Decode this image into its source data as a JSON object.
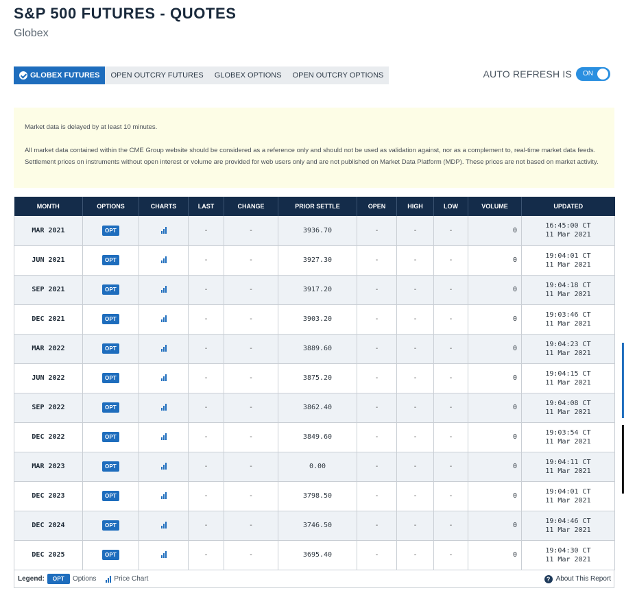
{
  "header": {
    "title": "S&P 500 FUTURES - QUOTES",
    "subtitle": "Globex"
  },
  "tabs": [
    {
      "label": "GLOBEX FUTURES",
      "active": true
    },
    {
      "label": "OPEN OUTCRY FUTURES",
      "active": false
    },
    {
      "label": "GLOBEX OPTIONS",
      "active": false
    },
    {
      "label": "OPEN OUTCRY OPTIONS",
      "active": false
    }
  ],
  "auto_refresh": {
    "label": "AUTO REFRESH IS",
    "state": "ON"
  },
  "notice": {
    "line1": "Market data is delayed by at least 10 minutes.",
    "line2": "All market data contained within the CME Group website should be considered as a reference only and should not be used as validation against, nor as a complement to, real-time market data feeds. Settlement prices on instruments without open interest or volume are provided for web users only and are not published on Market Data Platform (MDP). These prices are not based on market activity."
  },
  "table": {
    "columns": [
      "MONTH",
      "OPTIONS",
      "CHARTS",
      "LAST",
      "CHANGE",
      "PRIOR SETTLE",
      "OPEN",
      "HIGH",
      "LOW",
      "VOLUME",
      "UPDATED"
    ],
    "opt_label": "OPT",
    "rows": [
      {
        "month": "MAR 2021",
        "last": "-",
        "change": "-",
        "prior_settle": "3936.70",
        "open": "-",
        "high": "-",
        "low": "-",
        "volume": "0",
        "time": "16:45:00 CT",
        "date": "11 Mar 2021"
      },
      {
        "month": "JUN 2021",
        "last": "-",
        "change": "-",
        "prior_settle": "3927.30",
        "open": "-",
        "high": "-",
        "low": "-",
        "volume": "0",
        "time": "19:04:01 CT",
        "date": "11 Mar 2021"
      },
      {
        "month": "SEP 2021",
        "last": "-",
        "change": "-",
        "prior_settle": "3917.20",
        "open": "-",
        "high": "-",
        "low": "-",
        "volume": "0",
        "time": "19:04:18 CT",
        "date": "11 Mar 2021"
      },
      {
        "month": "DEC 2021",
        "last": "-",
        "change": "-",
        "prior_settle": "3903.20",
        "open": "-",
        "high": "-",
        "low": "-",
        "volume": "0",
        "time": "19:03:46 CT",
        "date": "11 Mar 2021"
      },
      {
        "month": "MAR 2022",
        "last": "-",
        "change": "-",
        "prior_settle": "3889.60",
        "open": "-",
        "high": "-",
        "low": "-",
        "volume": "0",
        "time": "19:04:23 CT",
        "date": "11 Mar 2021"
      },
      {
        "month": "JUN 2022",
        "last": "-",
        "change": "-",
        "prior_settle": "3875.20",
        "open": "-",
        "high": "-",
        "low": "-",
        "volume": "0",
        "time": "19:04:15 CT",
        "date": "11 Mar 2021"
      },
      {
        "month": "SEP 2022",
        "last": "-",
        "change": "-",
        "prior_settle": "3862.40",
        "open": "-",
        "high": "-",
        "low": "-",
        "volume": "0",
        "time": "19:04:08 CT",
        "date": "11 Mar 2021"
      },
      {
        "month": "DEC 2022",
        "last": "-",
        "change": "-",
        "prior_settle": "3849.60",
        "open": "-",
        "high": "-",
        "low": "-",
        "volume": "0",
        "time": "19:03:54 CT",
        "date": "11 Mar 2021"
      },
      {
        "month": "MAR 2023",
        "last": "-",
        "change": "-",
        "prior_settle": "0.00",
        "open": "-",
        "high": "-",
        "low": "-",
        "volume": "0",
        "time": "19:04:11 CT",
        "date": "11 Mar 2021"
      },
      {
        "month": "DEC 2023",
        "last": "-",
        "change": "-",
        "prior_settle": "3798.50",
        "open": "-",
        "high": "-",
        "low": "-",
        "volume": "0",
        "time": "19:04:01 CT",
        "date": "11 Mar 2021"
      },
      {
        "month": "DEC 2024",
        "last": "-",
        "change": "-",
        "prior_settle": "3746.50",
        "open": "-",
        "high": "-",
        "low": "-",
        "volume": "0",
        "time": "19:04:46 CT",
        "date": "11 Mar 2021"
      },
      {
        "month": "DEC 2025",
        "last": "-",
        "change": "-",
        "prior_settle": "3695.40",
        "open": "-",
        "high": "-",
        "low": "-",
        "volume": "0",
        "time": "19:04:30 CT",
        "date": "11 Mar 2021"
      }
    ]
  },
  "legend": {
    "label": "Legend:",
    "opt_badge": "OPT",
    "opt_text": "Options",
    "chart_text": "Price Chart",
    "about_link": "About This Report"
  },
  "icons": {
    "tab_active": "check-circle-icon",
    "charts": "bar-chart-icon",
    "about": "help-circle-icon"
  },
  "colors": {
    "accent": "#1e6dbd",
    "header_bg": "#142c4a",
    "notice_bg": "#fdfde6",
    "toggle_on": "#2a8fe0"
  }
}
